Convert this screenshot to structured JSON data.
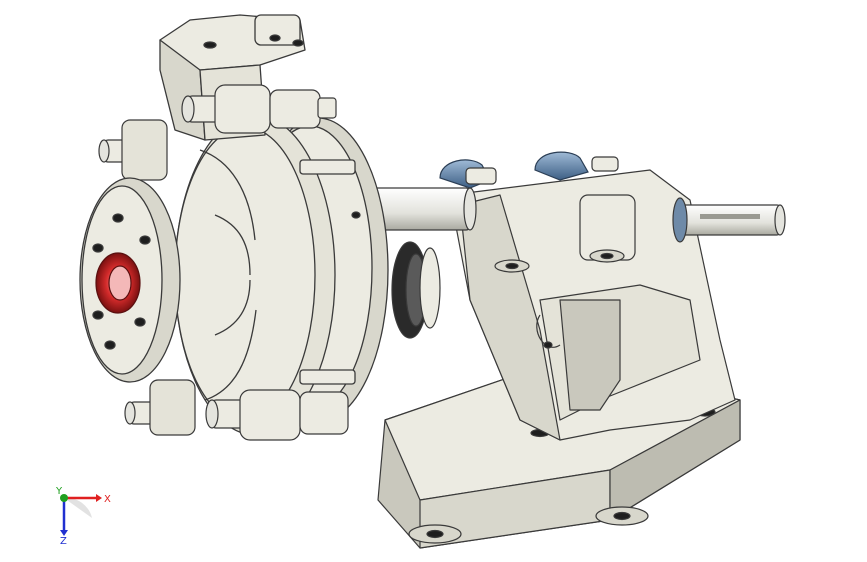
{
  "viewport": {
    "background": "#ffffff",
    "model": {
      "name": "slurry-pump-assembly",
      "colors": {
        "body": "#ecebe2",
        "body_shadow": "#c9c8bd",
        "body_dark": "#a8a79c",
        "edge": "#3a3a3a",
        "impeller_red": "#d42b2b",
        "bearing_blue": "#5a7fa8",
        "shaft": "#e4e4de",
        "hole": "#1e1e1e"
      }
    },
    "triad": {
      "x_label": "X",
      "y_label": "Y",
      "z_label": "Z",
      "colors": {
        "x": "#e02020",
        "y": "#20a020",
        "z": "#2030d0"
      }
    }
  }
}
